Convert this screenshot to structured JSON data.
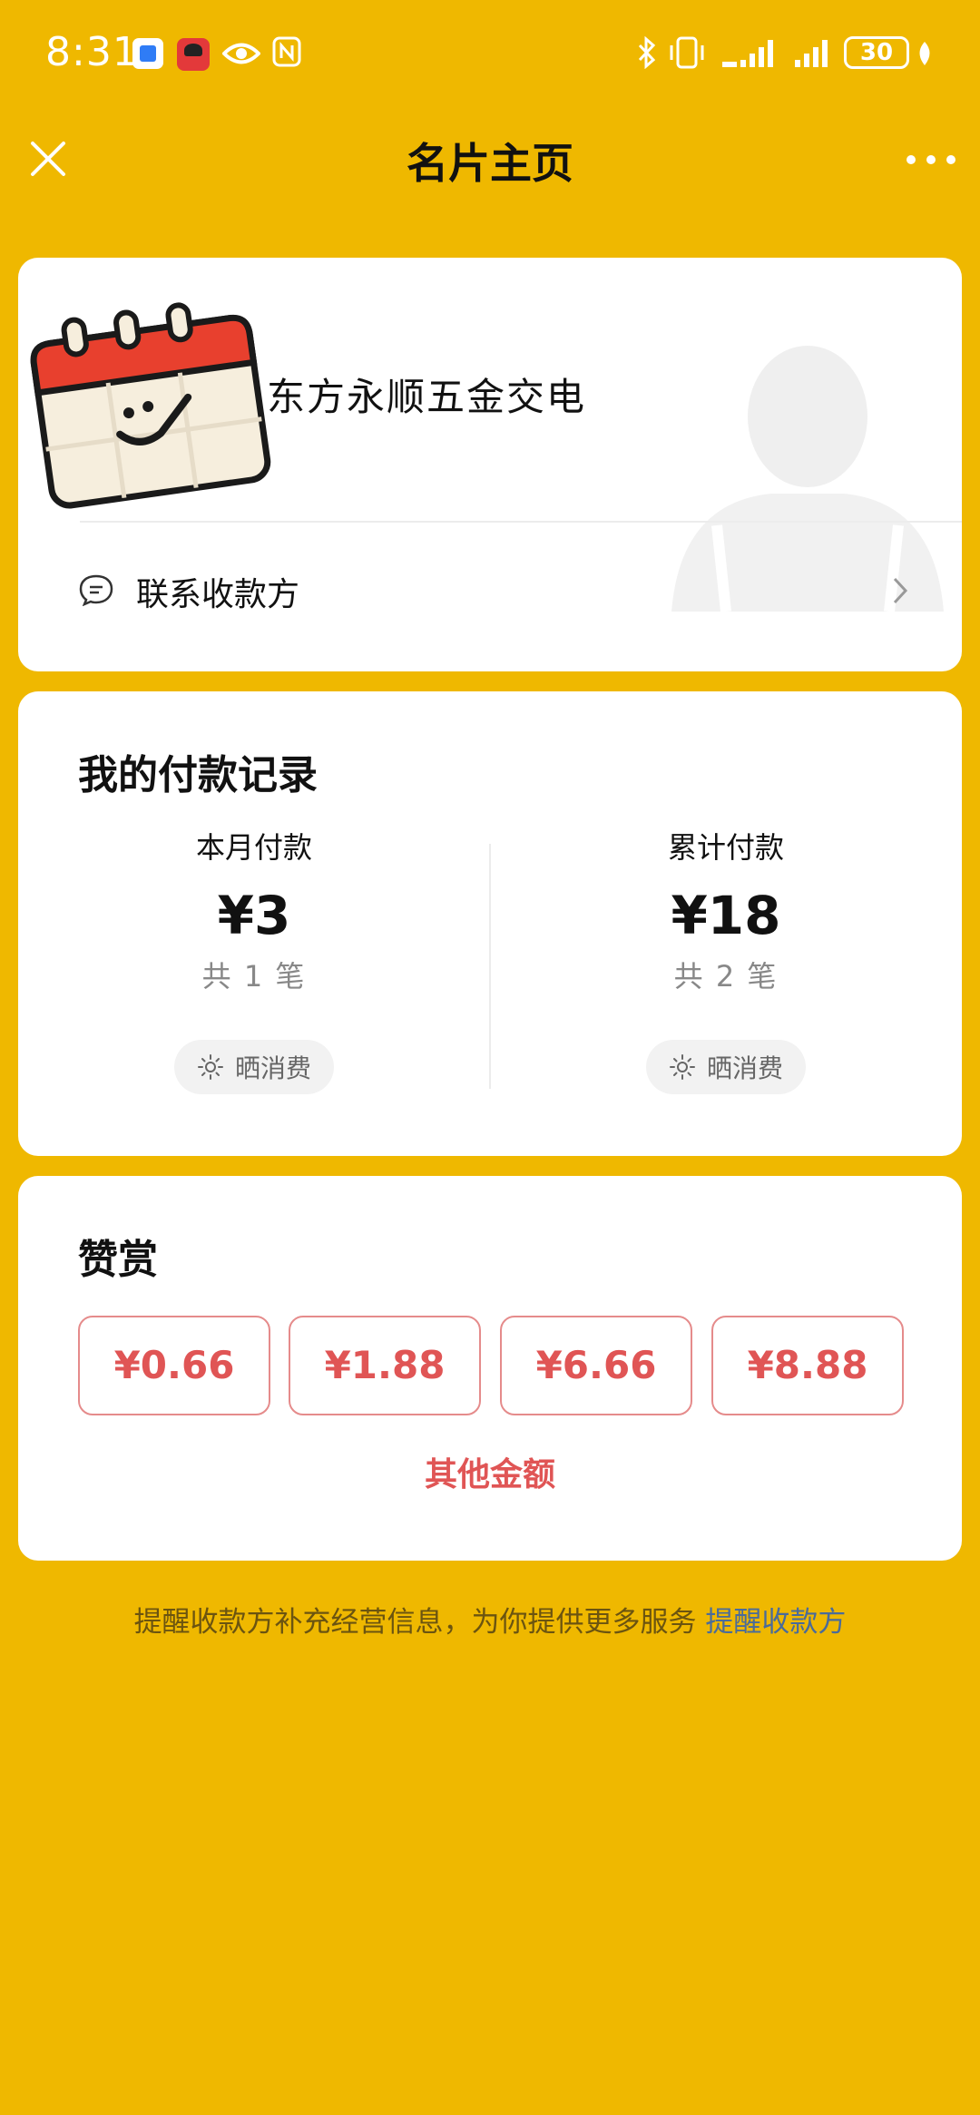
{
  "status_bar": {
    "time": "8:31",
    "battery_level": "30",
    "icons": [
      "app-notification-icon",
      "app-notification-icon",
      "eye-icon",
      "nfc-icon",
      "bluetooth-icon",
      "vibrate-icon",
      "signal-icon",
      "signal-icon",
      "battery-icon",
      "leaf-icon"
    ]
  },
  "nav": {
    "title": "名片主页",
    "close_icon": "close-icon",
    "more_icon": "more-icon"
  },
  "profile": {
    "merchant_name": "东方永顺五金交电",
    "contact_label": "联系收款方",
    "contact_icon": "chat-icon",
    "chevron_icon": "chevron-right-icon"
  },
  "records": {
    "title": "我的付款记录",
    "month": {
      "label": "本月付款",
      "amount": "¥3",
      "count": "共 1 笔",
      "share_label": "晒消费"
    },
    "total": {
      "label": "累计付款",
      "amount": "¥18",
      "count": "共 2 笔",
      "share_label": "晒消费"
    }
  },
  "reward": {
    "title": "赞赏",
    "amounts": [
      "¥0.66",
      "¥1.88",
      "¥6.66",
      "¥8.88"
    ],
    "other_label": "其他金额"
  },
  "footer": {
    "tip": "提醒收款方补充经营信息，为你提供更多服务",
    "link": "提醒收款方"
  },
  "colors": {
    "background": "#EFB800",
    "card": "#FFFFFF",
    "accent_red": "#E05555",
    "link_blue": "#4A6B9A"
  }
}
